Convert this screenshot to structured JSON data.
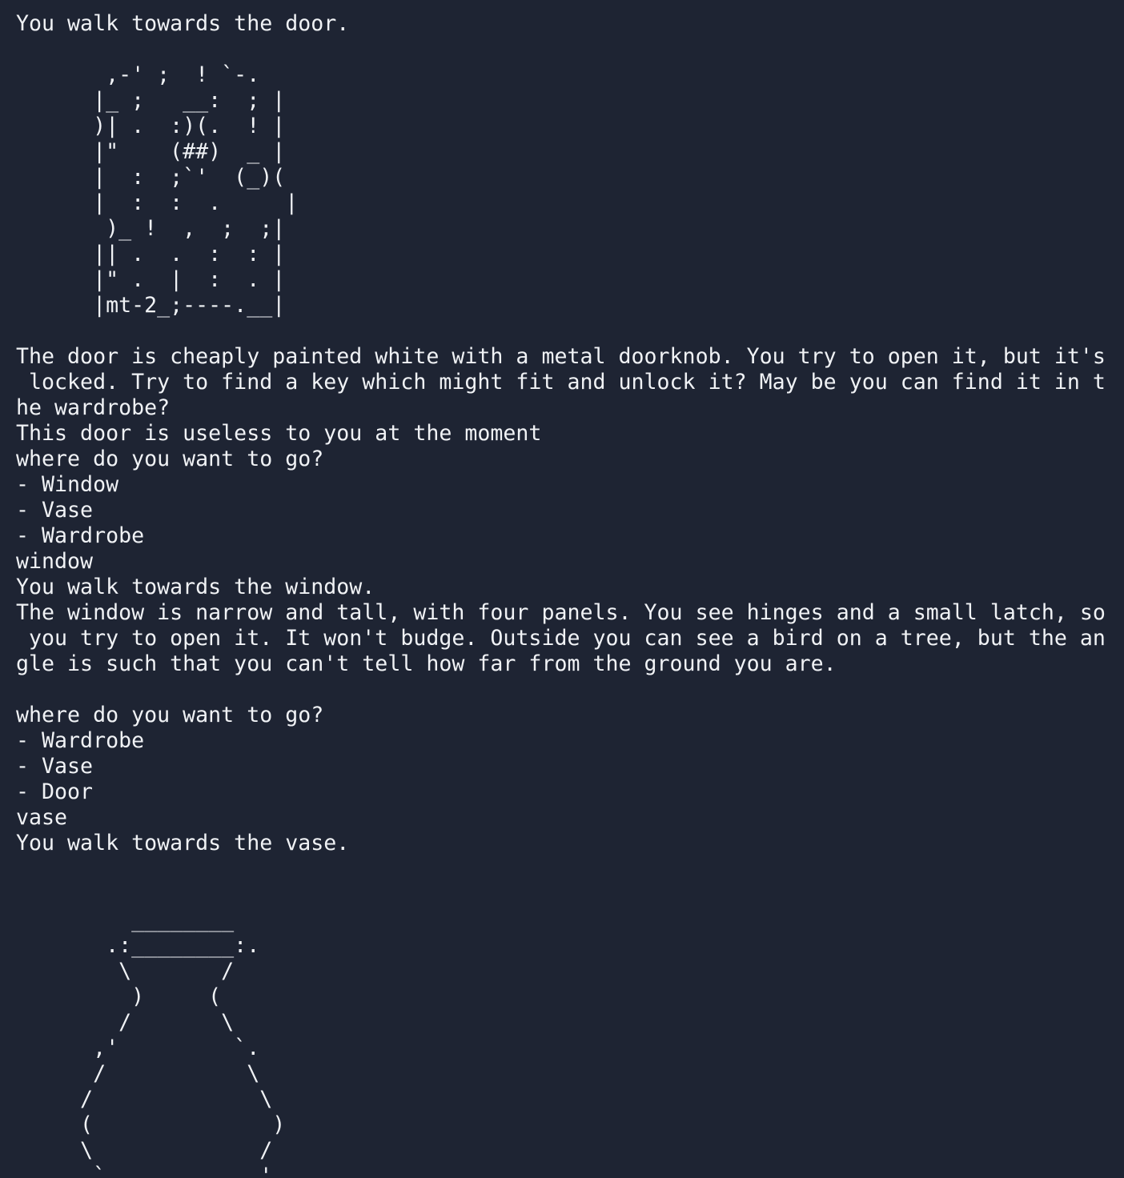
{
  "terminal": {
    "lines": [
      "You walk towards the door.",
      "",
      "       ,-' ;  ! `-.",
      "      |_ ;   __:  ; |",
      "      )| .  :)(.  ! |",
      "      |\"    (##)  _ |",
      "      |  :  ;`'  (_)(",
      "      |  :  :  .     |",
      "       )_ !  ,  ;  ;|",
      "      || .  .  :  : |",
      "      |\" .  |  :  . |",
      "      |mt-2_;----.__|",
      "",
      "The door is cheaply painted white with a metal doorknob. You try to open it, but it's",
      " locked. Try to find a key which might fit and unlock it? May be you can find it in t",
      "he wardrobe?",
      "This door is useless to you at the moment",
      "where do you want to go?",
      "- Window",
      "- Vase",
      "- Wardrobe",
      "window",
      "You walk towards the window.",
      "The window is narrow and tall, with four panels. You see hinges and a small latch, so",
      " you try to open it. It won't budge. Outside you can see a bird on a tree, but the an",
      "gle is such that you can't tell how far from the ground you are.",
      "",
      "where do you want to go?",
      "- Wardrobe",
      "- Vase",
      "- Door",
      "vase",
      "You walk towards the vase.",
      "",
      "",
      "         ________",
      "       .:________:.",
      "        \\       /",
      "         )     (",
      "        /       \\",
      "      ,'         `.",
      "      /           \\",
      "     /             \\",
      "     (              )",
      "     \\             /",
      "      `.          ,'"
    ]
  }
}
